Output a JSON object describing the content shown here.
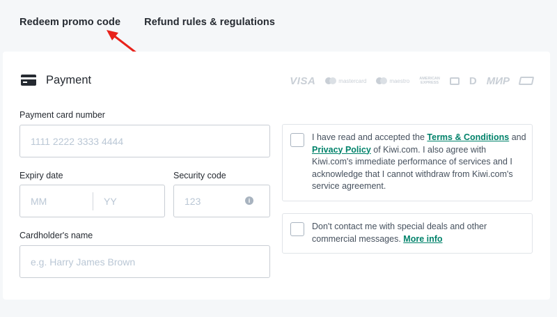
{
  "top_links": {
    "promo": "Redeem promo code",
    "refund": "Refund rules & regulations"
  },
  "payment": {
    "title": "Payment",
    "brands": {
      "visa": "VISA",
      "mastercard": "mastercard",
      "maestro": "maestro",
      "amex_line1": "AMERICAN",
      "amex_line2": "EXPRESS",
      "mir": "МИР"
    },
    "card_number": {
      "label": "Payment card number",
      "placeholder": "1111 2222 3333 4444"
    },
    "expiry": {
      "label": "Expiry date",
      "month_placeholder": "MM",
      "year_placeholder": "YY"
    },
    "security": {
      "label": "Security code",
      "placeholder": "123",
      "info_glyph": "i"
    },
    "cardholder": {
      "label": "Cardholder's name",
      "placeholder": "e.g. Harry James Brown"
    }
  },
  "consent_terms": {
    "text_1": "I have read and accepted the ",
    "terms_link": "Terms & Conditions",
    "text_2": " and",
    "privacy_link": "Privacy Policy",
    "text_3": " of Kiwi.com. I also agree with Kiwi.com's immediate performance of services and I acknowledge that I cannot withdraw from Kiwi.com's service agreement.",
    "checked": false
  },
  "consent_marketing": {
    "text_1": "Don't contact me with special deals and other commercial messages. ",
    "more_link": "More info",
    "checked": false
  },
  "colors": {
    "accent_link": "#00826a",
    "annotation_arrow": "#e8221b"
  },
  "icons": [
    "credit-card-icon",
    "info-icon",
    "checkbox-icon",
    "arrow-annotation"
  ]
}
